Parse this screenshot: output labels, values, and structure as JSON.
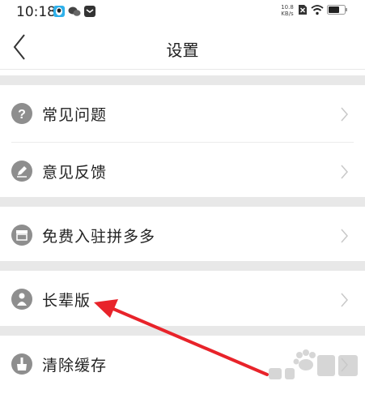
{
  "status_bar": {
    "time": "10:18",
    "net_speed": "10.8 KB/s"
  },
  "header": {
    "title": "设置"
  },
  "settings": {
    "faq": "常见问题",
    "feedback": "意见反馈",
    "merchant": "免费入驻拼多多",
    "elder_mode": "长辈版",
    "clear_cache": "清除缓存"
  },
  "colors": {
    "annotation_arrow": "#e8232a",
    "icon_gray": "#8e8e8e",
    "section_gap": "#e8e8e8"
  }
}
